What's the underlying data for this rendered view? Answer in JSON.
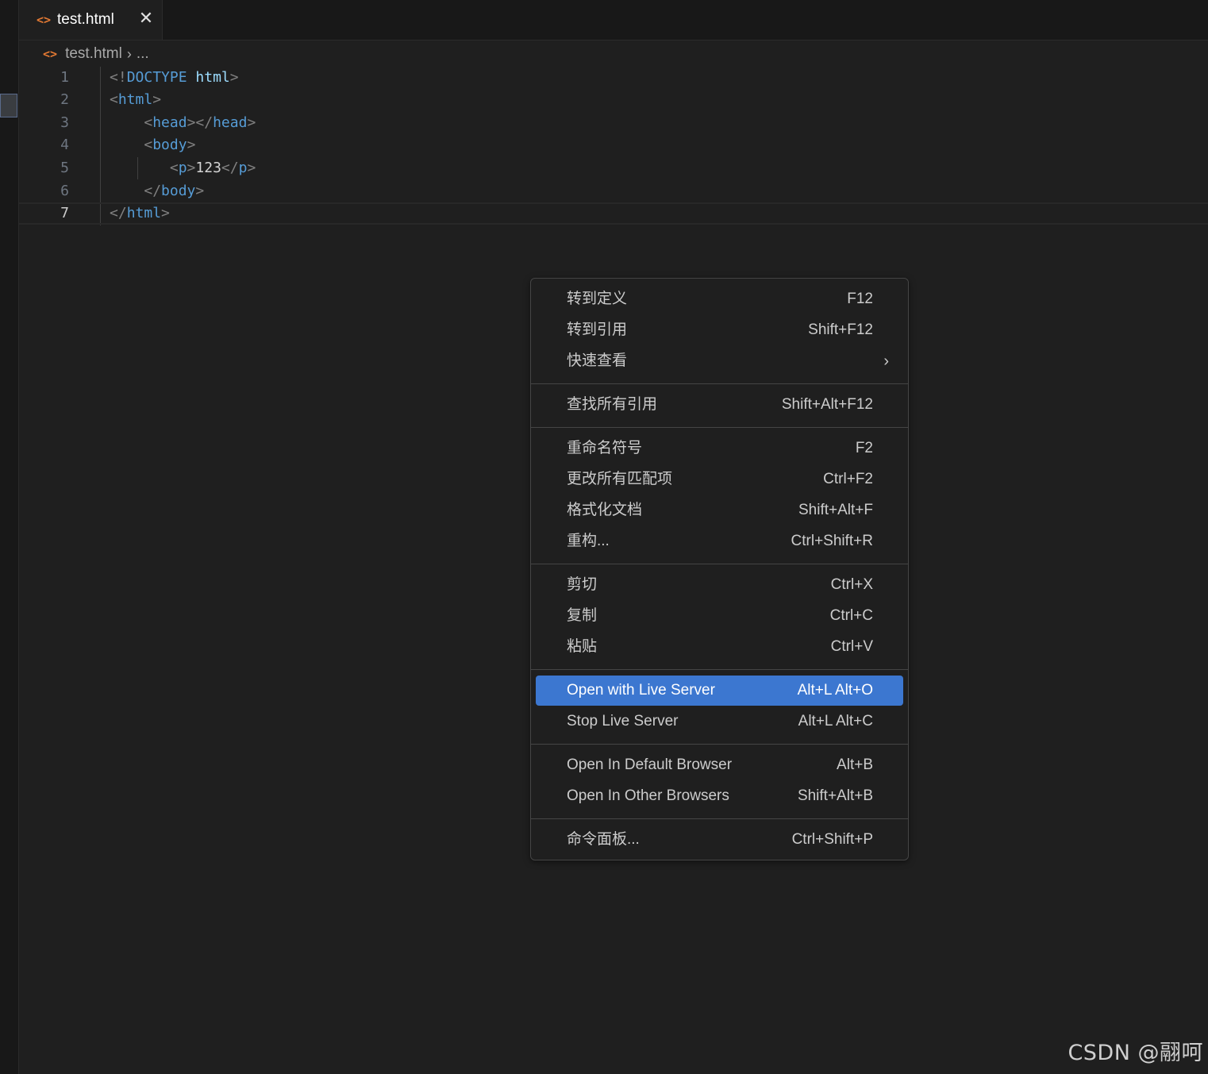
{
  "tab": {
    "label": "test.html",
    "icon": "html-file-icon"
  },
  "breadcrumb": {
    "file": "test.html",
    "more": "..."
  },
  "editor": {
    "lines": [
      {
        "n": "1",
        "doctype_open": "<!",
        "doctype": "DOCTYPE",
        "name": "html",
        "close": ">"
      },
      {
        "n": "2",
        "open": "<",
        "tag": "html",
        "close": ">"
      },
      {
        "n": "3",
        "open": "<",
        "tag": "head",
        "mid": "></",
        "tag2": "head",
        "close": ">"
      },
      {
        "n": "4",
        "open": "<",
        "tag": "body",
        "close": ">"
      },
      {
        "n": "5",
        "open": "<",
        "tag": "p",
        "mid": ">",
        "text": "123",
        "open2": "</",
        "tag2": "p",
        "close": ">"
      },
      {
        "n": "6",
        "open": "</",
        "tag": "body",
        "close": ">"
      },
      {
        "n": "7",
        "open": "</",
        "tag": "html",
        "close": ">"
      }
    ]
  },
  "menu": {
    "items": [
      {
        "label": "转到定义",
        "key": "F12"
      },
      {
        "label": "转到引用",
        "key": "Shift+F12"
      },
      {
        "label": "快速查看",
        "key": ""
      },
      {
        "label": "查找所有引用",
        "key": "Shift+Alt+F12"
      },
      {
        "label": "重命名符号",
        "key": "F2"
      },
      {
        "label": "更改所有匹配项",
        "key": "Ctrl+F2"
      },
      {
        "label": "格式化文档",
        "key": "Shift+Alt+F"
      },
      {
        "label": "重构...",
        "key": "Ctrl+Shift+R"
      },
      {
        "label": "剪切",
        "key": "Ctrl+X"
      },
      {
        "label": "复制",
        "key": "Ctrl+C"
      },
      {
        "label": "粘贴",
        "key": "Ctrl+V"
      },
      {
        "label": "Open with Live Server",
        "key": "Alt+L Alt+O"
      },
      {
        "label": "Stop Live Server",
        "key": "Alt+L Alt+C"
      },
      {
        "label": "Open In Default Browser",
        "key": "Alt+B"
      },
      {
        "label": "Open In Other Browsers",
        "key": "Shift+Alt+B"
      },
      {
        "label": "命令面板...",
        "key": "Ctrl+Shift+P"
      }
    ],
    "active_item": "Open with Live Server",
    "accent": "#3c77d0"
  },
  "watermark": "CSDN @翮呵"
}
